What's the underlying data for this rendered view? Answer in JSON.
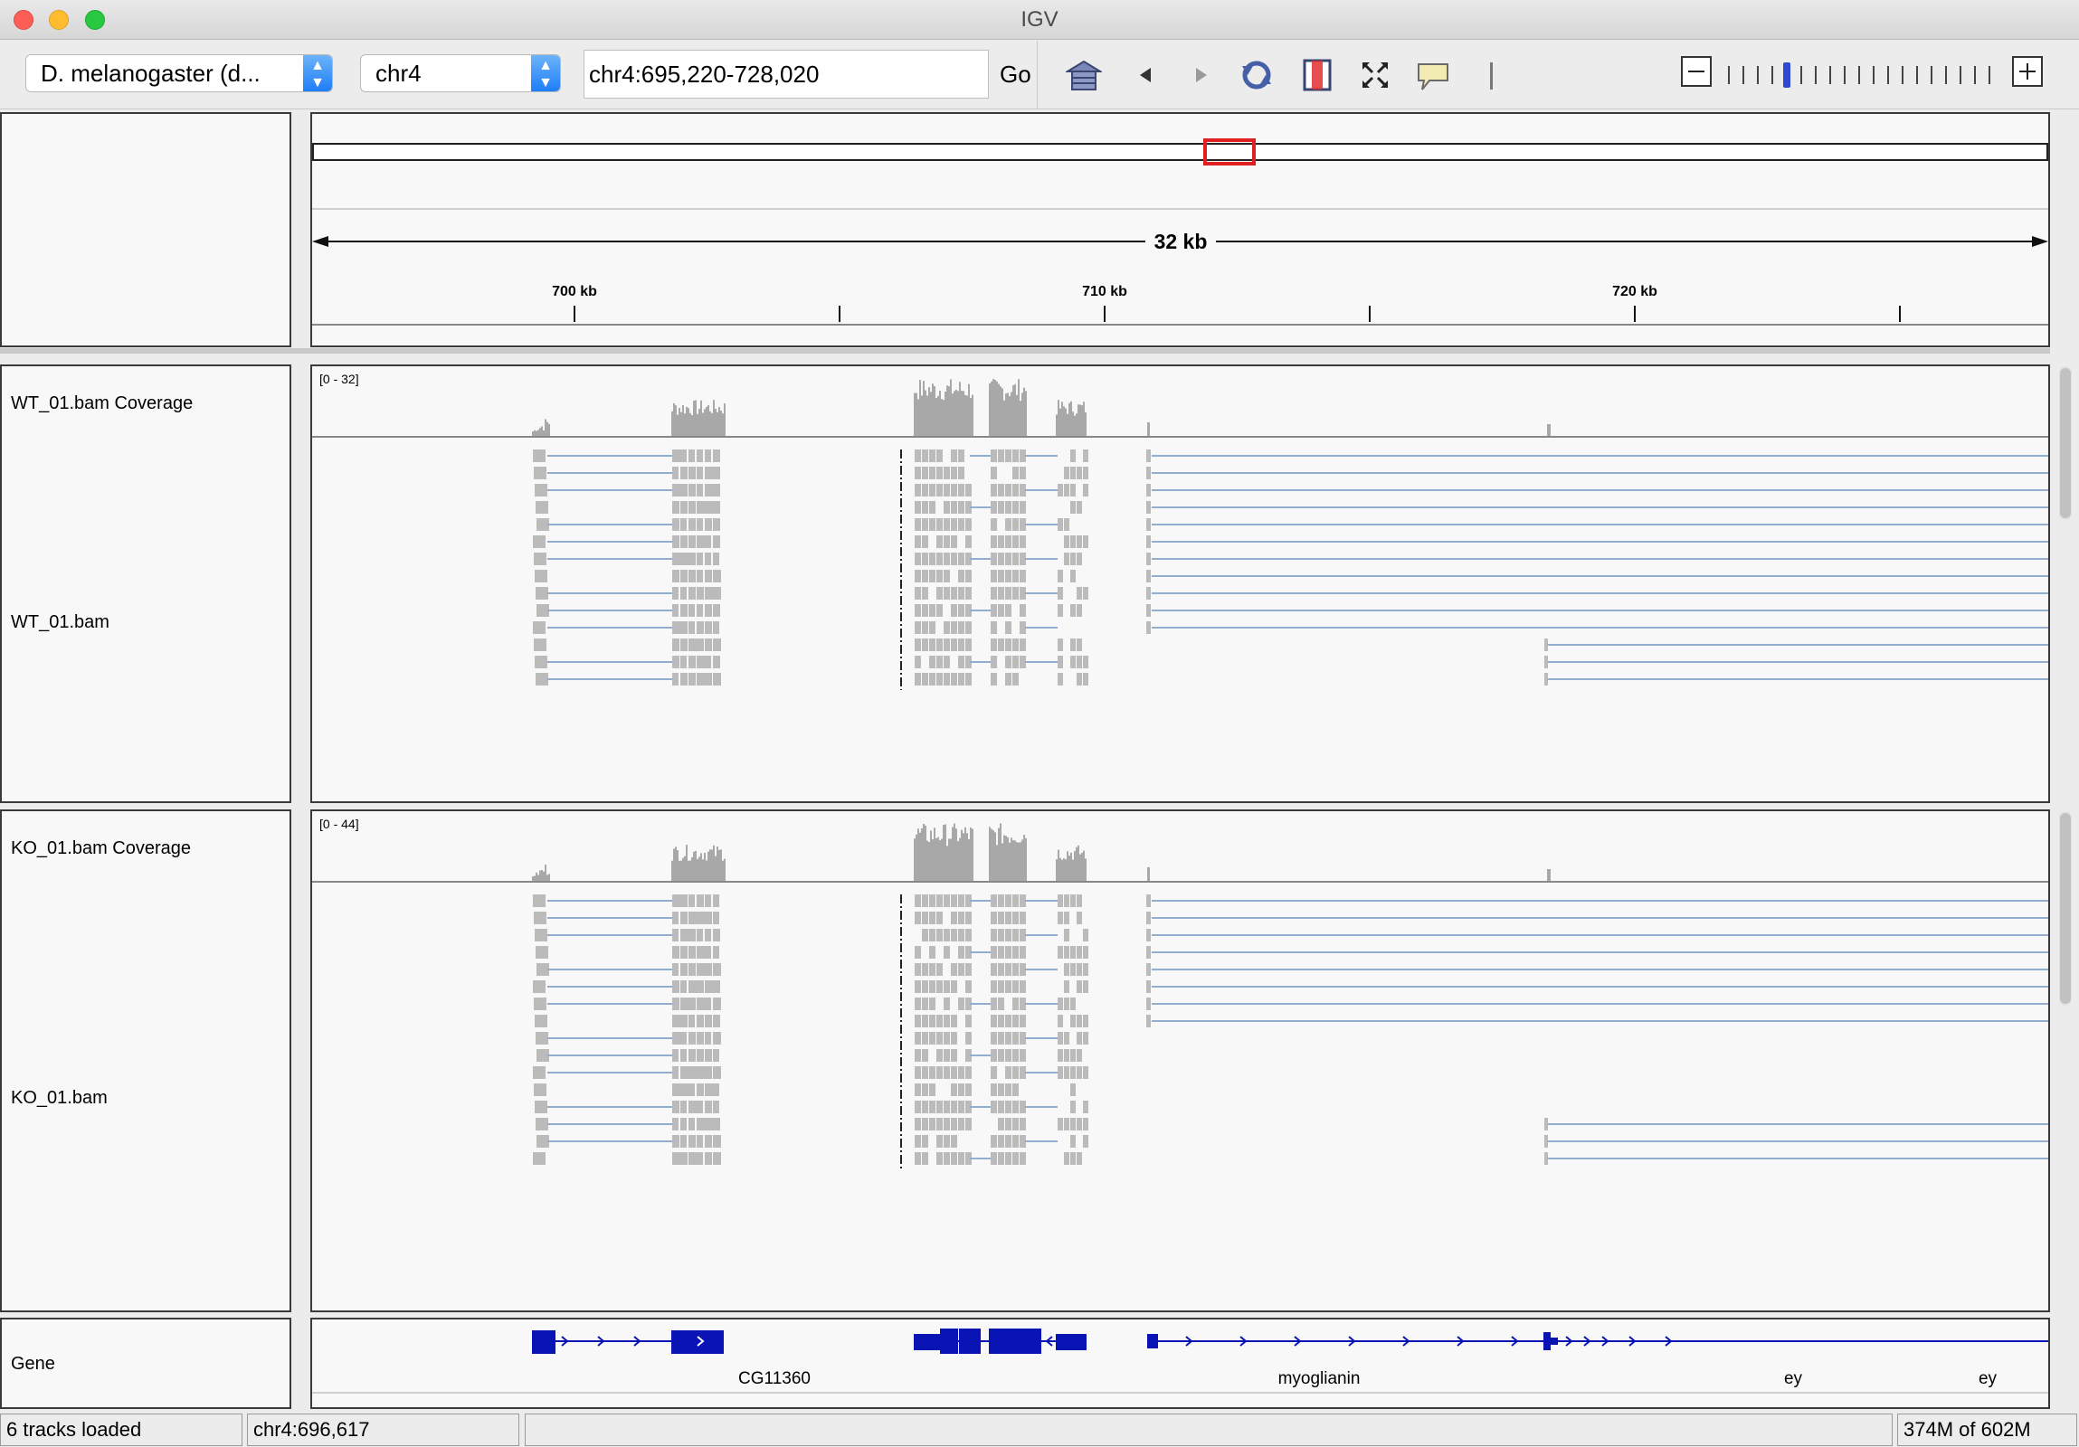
{
  "window": {
    "title": "IGV"
  },
  "toolbar": {
    "genome": "D. melanogaster (d...",
    "chromosome": "chr4",
    "locus": "chr4:695,220-728,020",
    "go_label": "Go",
    "zoom_level": 4,
    "zoom_ticks": 19
  },
  "ruler": {
    "span_label": "32 kb",
    "ticks": [
      "700 kb",
      "710 kb",
      "720 kb"
    ]
  },
  "tracks": [
    {
      "name": "WT_01.bam Coverage",
      "range": "[0 - 32]"
    },
    {
      "name": "WT_01.bam"
    },
    {
      "name": "KO_01.bam Coverage",
      "range": "[0 - 44]"
    },
    {
      "name": "KO_01.bam"
    },
    {
      "name": "Gene"
    }
  ],
  "genes": [
    "CG11360",
    "myoglianin",
    "ey",
    "ey"
  ],
  "status": {
    "tracks_loaded": "6 tracks loaded",
    "position": "chr4:696,617",
    "message": "",
    "memory": "374M of 602M"
  },
  "colors": {
    "coverage": "#a8a8a8",
    "read": "#bbbbbb",
    "junction": "#92aecf",
    "gene": "#0a14b4",
    "region_box": "#e02020"
  }
}
